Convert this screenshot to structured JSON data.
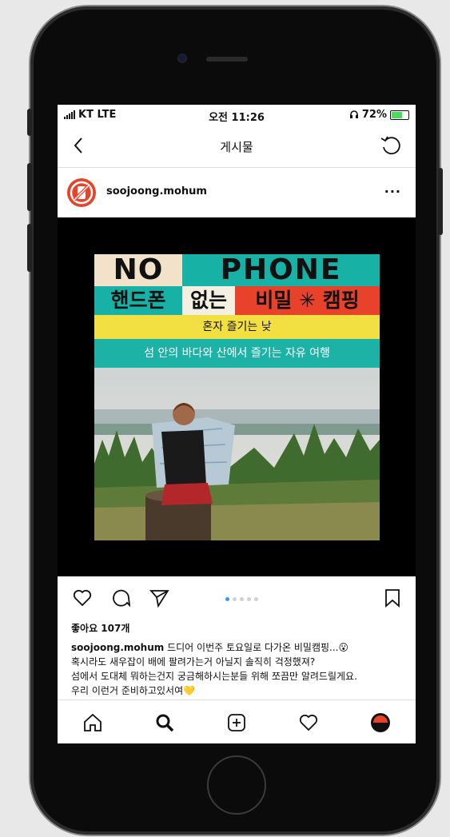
{
  "status_bar": {
    "carrier": "KT LTE",
    "time": "오전 11:26",
    "battery_percent": "72%",
    "battery_level": 0.72
  },
  "nav": {
    "title": "게시물",
    "back_icon": "chevron-left-icon",
    "refresh_icon": "refresh-icon"
  },
  "post": {
    "username": "soojoong.mohum",
    "more_label": "···",
    "poster": {
      "no": "NO",
      "phone": "PHONE",
      "kr_a": "핸드폰",
      "kr_b": "없는",
      "kr_c": "비밀 ✳ 캠핑",
      "yellow_line": "혼자 즐기는 낮",
      "teal_line": "섬 안의 바다와 산에서 즐기는 자유 여행"
    },
    "carousel": {
      "count": 5,
      "active": 0
    },
    "likes": "좋아요 107개",
    "caption_user": "soojoong.mohum",
    "caption_lines": [
      "드디어 이번주 토요일로 다가온 비밀캠핑...😮",
      "혹시라도 새우잡이 배에 팔려가는거 아닐지 솔직히 걱정했져?",
      "섬에서 도대체 뭐하는건지 궁금해하시는분들 위해 쪼끔만 알려드릴게요.",
      "우리 이런거 준비하고있서여💛"
    ]
  },
  "tabs": [
    "home-icon",
    "search-icon",
    "add-post-icon",
    "heart-icon",
    "profile-avatar"
  ],
  "colors": {
    "teal": "#18b1a6",
    "red": "#e8432a",
    "yellow": "#f2e042",
    "cream": "#f1e2c9",
    "blue_dot": "#3897f0"
  }
}
